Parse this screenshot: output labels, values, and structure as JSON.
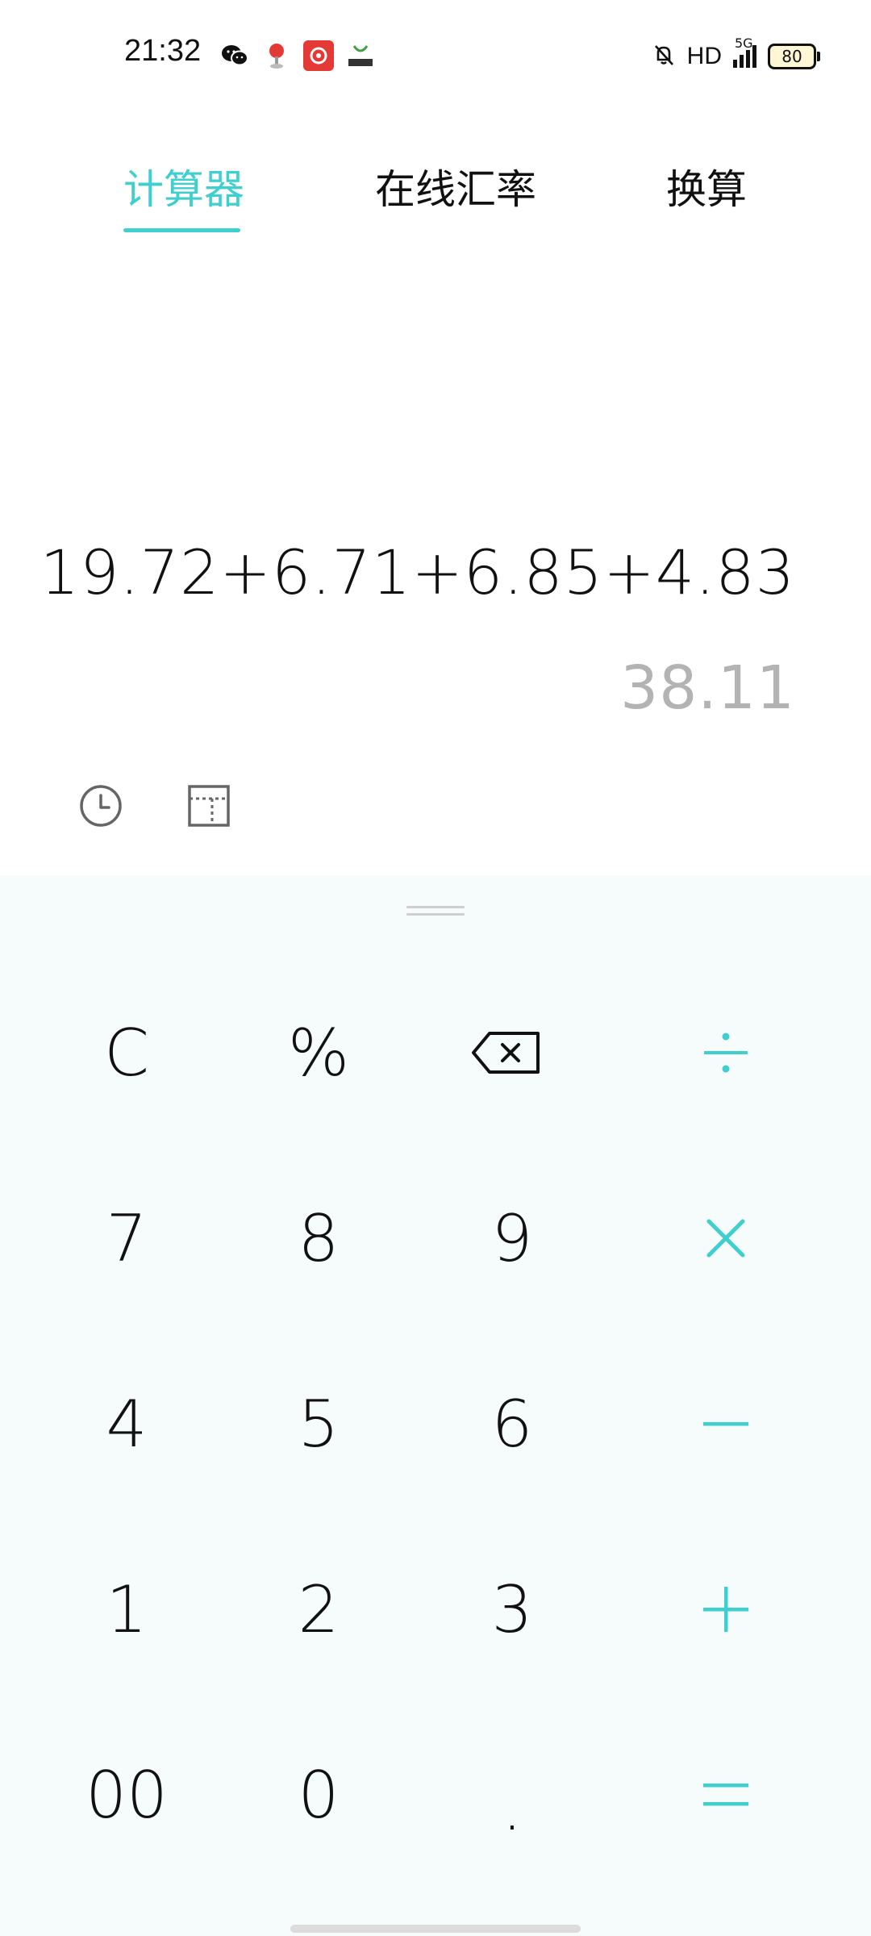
{
  "status_bar": {
    "time": "21:32",
    "network_label": "HD",
    "signal_label": "5G",
    "battery_level": "80",
    "app_icons": [
      "wechat-icon",
      "maps-icon",
      "netease-music-icon",
      "tv-app-icon"
    ]
  },
  "tabs": [
    {
      "label": "计算器",
      "active": true
    },
    {
      "label": "在线汇率",
      "active": false
    },
    {
      "label": "换算",
      "active": false
    }
  ],
  "display": {
    "expression": "19.72+6.71+6.85+4.83",
    "result": "38.11"
  },
  "tools": [
    "history-icon",
    "scientific-mode-icon"
  ],
  "keypad": {
    "row1": [
      "C",
      "%",
      "backspace",
      "÷"
    ],
    "row2": [
      "7",
      "8",
      "9",
      "×"
    ],
    "row3": [
      "4",
      "5",
      "6",
      "−"
    ],
    "row4": [
      "1",
      "2",
      "3",
      "+"
    ],
    "row5": [
      "00",
      "0",
      ".",
      "="
    ]
  },
  "colors": {
    "accent": "#3fcfcf",
    "keypad_bg": "#f6fbfb",
    "result_text": "#b3b3b3"
  }
}
